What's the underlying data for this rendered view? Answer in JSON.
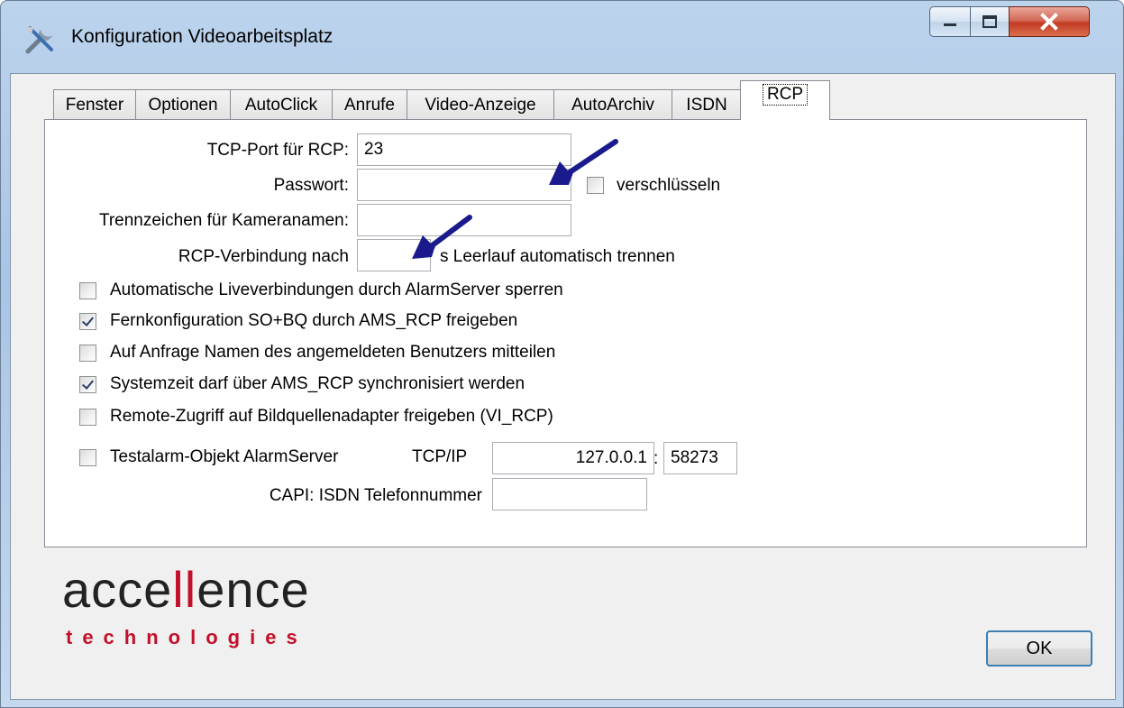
{
  "window": {
    "title": "Konfiguration Videoarbeitsplatz",
    "icon": "tools-icon"
  },
  "caption_buttons": [
    "minimize",
    "maximize",
    "close"
  ],
  "tabs": [
    {
      "label": "Fenster",
      "active": false
    },
    {
      "label": "Optionen",
      "active": false
    },
    {
      "label": "AutoClick",
      "active": false
    },
    {
      "label": "Anrufe",
      "active": false
    },
    {
      "label": "Video-Anzeige",
      "active": false
    },
    {
      "label": "AutoArchiv",
      "active": false
    },
    {
      "label": "ISDN",
      "active": false
    },
    {
      "label": "RCP",
      "active": true
    }
  ],
  "rcp": {
    "tcp_port_label": "TCP-Port für RCP:",
    "tcp_port_value": "23",
    "password_label": "Passwort:",
    "password_value": "",
    "encrypt_label": "verschlüsseln",
    "encrypt_checked": false,
    "separator_label": "Trennzeichen für Kameranamen:",
    "separator_value": "",
    "idle_label_prefix": "RCP-Verbindung nach",
    "idle_value": "",
    "idle_label_suffix": "s Leerlauf automatisch trennen",
    "options": [
      {
        "label": "Automatische Liveverbindungen durch AlarmServer sperren",
        "checked": false
      },
      {
        "label": "Fernkonfiguration SO+BQ durch AMS_RCP freigeben",
        "checked": true
      },
      {
        "label": "Auf Anfrage Namen des angemeldeten Benutzers mitteilen",
        "checked": false
      },
      {
        "label": "Systemzeit darf über AMS_RCP synchronisiert werden",
        "checked": true
      },
      {
        "label": "Remote-Zugriff auf Bildquellenadapter freigeben (VI_RCP)",
        "checked": false
      }
    ],
    "testalarm_label": "Testalarm-Objekt AlarmServer",
    "testalarm_checked": false,
    "tcpip_label": "TCP/IP",
    "ip_value": "127.0.0.1",
    "port_separator": ":",
    "port_value": "58273",
    "capi_label": "CAPI: ISDN Telefonnummer",
    "capi_value": ""
  },
  "annotation_color": "#1a1a8c",
  "logo": {
    "main": "accellence",
    "sub": "technologies",
    "accent_color": "#c3102a"
  },
  "ok_label": "OK"
}
